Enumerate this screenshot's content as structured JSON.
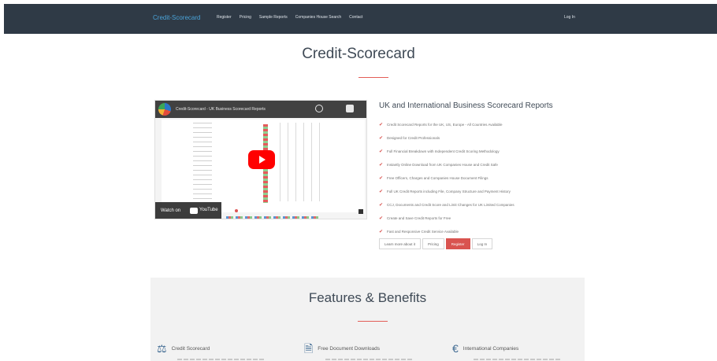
{
  "nav": {
    "brand": "Credit-Scorecard",
    "links": [
      "Register",
      "Pricing",
      "Sample Reports",
      "Companies House Search",
      "Contact"
    ],
    "login": "Log In"
  },
  "page": {
    "title": "Credit-Scorecard"
  },
  "video": {
    "title": "Credit-Scorecard - UK Business Scorecard Reports",
    "watch_on": "Watch on",
    "youtube": "YouTube"
  },
  "info": {
    "heading": "UK and International Business Scorecard Reports",
    "features": [
      "Credit Scorecard Reports for the UK, US, Europe - All Countries Available",
      "Designed for Credit Professionals",
      "Full Financial Breakdown with Independent Credit Scoring Methodology",
      "Instantly Online Download from UK Companies House and Credit Safe",
      "Free Officers, Charges and Companies House Document Filings",
      "Full UK Credit Reports including File, Company Structure and Payment History",
      "CCJ, Documents and Credit Score and Limit Changes for UK Limited Companies",
      "Create and Save Credit Reports for Free",
      "Fast and Responsive Credit Service Available"
    ],
    "buttons": {
      "learn_more": "Learn more about it",
      "pricing": "Pricing",
      "register": "Register",
      "login": "Log In"
    }
  },
  "features_section": {
    "title": "Features & Benefits",
    "columns": [
      {
        "icon": "scale-icon",
        "label": "Credit Scorecard"
      },
      {
        "icon": "document-icon",
        "label": "Free Document Downloads"
      },
      {
        "icon": "euro-icon",
        "label": "International Companies"
      }
    ]
  },
  "colors": {
    "navbar": "#2f3a46",
    "brand": "#4aa3d8",
    "accent": "#d9534f",
    "text_dark": "#3f4a56",
    "panel": "#f2f2f2"
  }
}
